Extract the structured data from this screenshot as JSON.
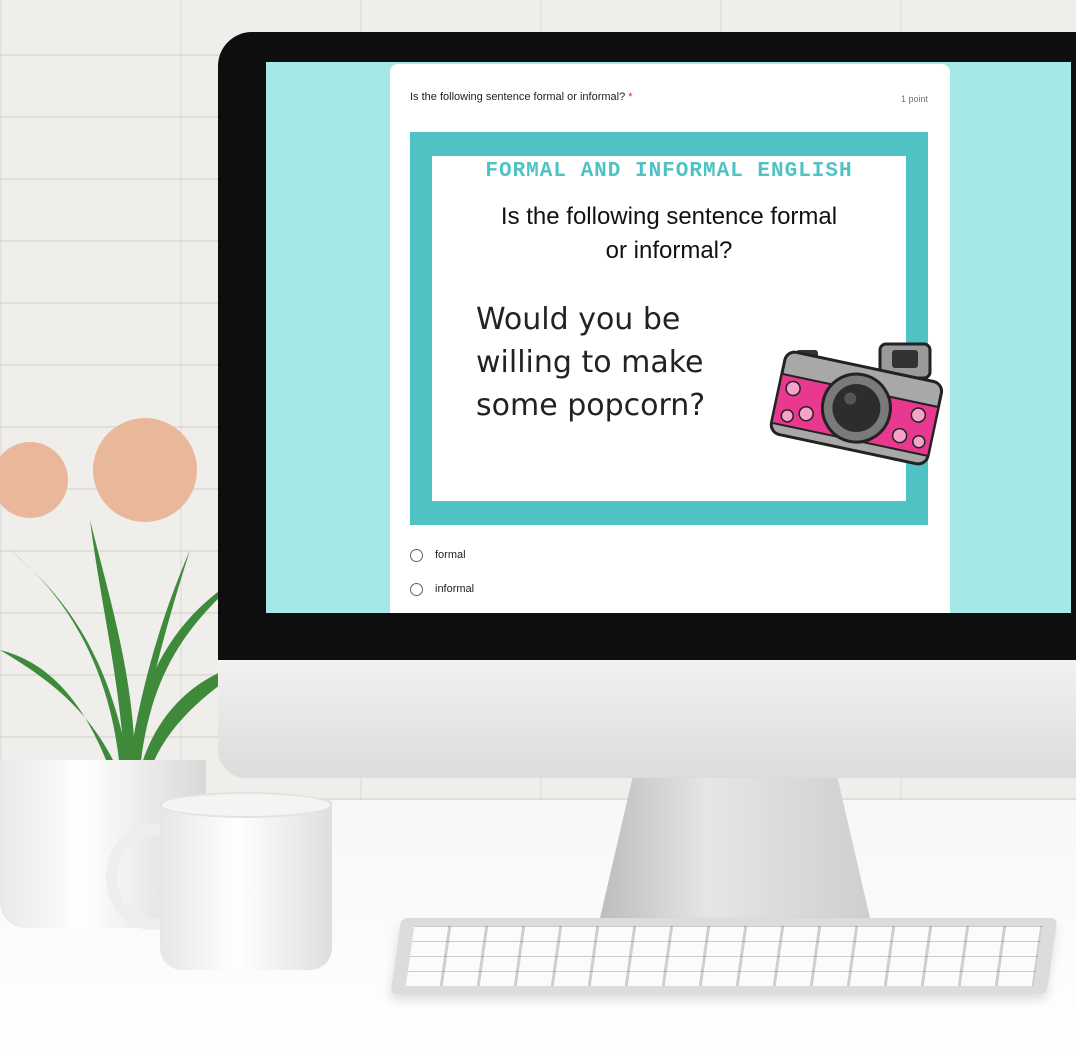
{
  "question": {
    "title": "Is the following sentence formal or informal?",
    "required_marker": "*",
    "points": "1 point"
  },
  "slide": {
    "header": "FORMAL AND INFORMAL ENGLISH",
    "question_line1": "Is the following sentence formal",
    "question_line2": "or informal?",
    "sentence_line1": "Would you be",
    "sentence_line2": "willing to make",
    "sentence_line3": "some popcorn?"
  },
  "options": [
    {
      "label": "formal",
      "selected": false
    },
    {
      "label": "informal",
      "selected": false
    }
  ],
  "colors": {
    "screen_bg": "#a6e8e6",
    "slide_border": "#4fc2c4",
    "required": "#d93025",
    "camera_pink": "#e8388f"
  },
  "icons": [
    "camera-icon",
    "radio-unchecked-icon"
  ]
}
